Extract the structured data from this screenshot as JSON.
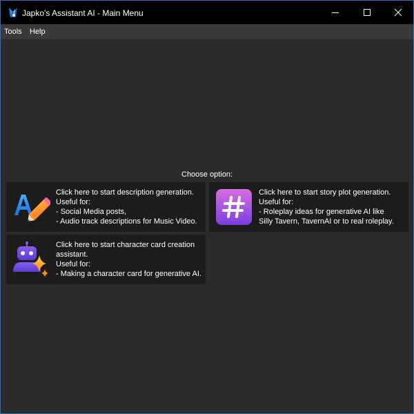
{
  "window": {
    "title": "Japko's Assistant AI - Main Menu",
    "icon": "app-logo-icon",
    "controls": {
      "minimize": "minimize-icon",
      "maximize": "maximize-icon",
      "close": "close-icon"
    }
  },
  "menu": {
    "tools": "Tools",
    "help": "Help"
  },
  "main": {
    "choose_label": "Choose option:",
    "cards": [
      {
        "icon": "text-pencil-icon",
        "lines": [
          "Click here to start description generation.",
          "Useful for:",
          "- Social Media posts,",
          "- Audio track descriptions for Music Video."
        ]
      },
      {
        "icon": "hashtag-icon",
        "lines": [
          "Click here to start story plot generation.",
          "Useful for:",
          "- Roleplay ideas for generative AI like",
          "Silly Tavern, TavernAI or to real roleplay."
        ]
      },
      {
        "icon": "robot-sparkle-icon",
        "lines": [
          "Click here to start character card creation",
          "assistant.",
          "Useful for:",
          "- Making a character card for generative AI."
        ]
      }
    ]
  },
  "colors": {
    "title_bar": "#000000",
    "menu_bar": "#3a3a3a",
    "background": "#2b2b2b",
    "card": "#1c1c1c",
    "window_border": "#2a6fc0",
    "hashtag_gradient_top": "#d86ee0",
    "hashtag_gradient_bottom": "#7a3fe0"
  }
}
